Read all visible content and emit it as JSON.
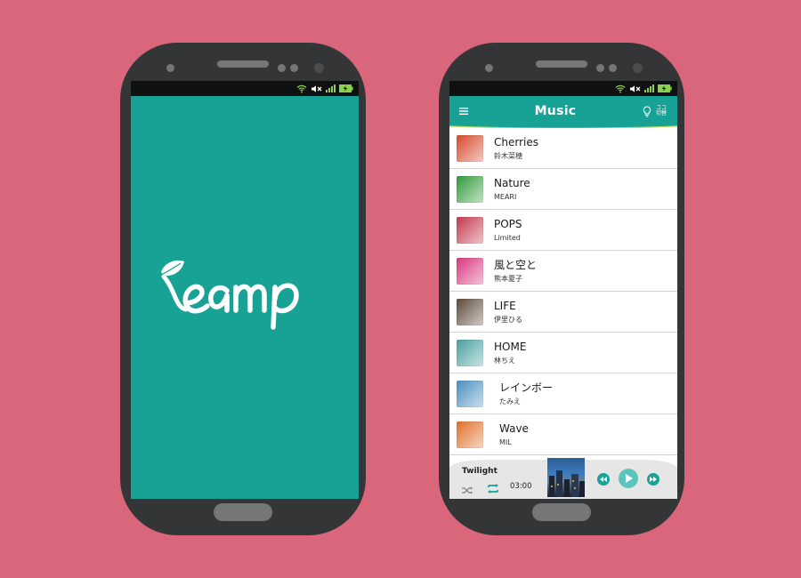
{
  "splash": {
    "logo_text": "eamp",
    "colors": {
      "background": "#17a295",
      "logo": "#ffffff"
    }
  },
  "status_bar": {
    "icons": [
      "wifi-icon",
      "mute-icon",
      "signal-icon",
      "battery-charging-icon"
    ]
  },
  "app": {
    "title": "Music",
    "menu_icon": "hamburger-icon",
    "right_icon": "lightbulb-icon",
    "right_badge": "ココ\n切替",
    "accent": "#17a295",
    "tracks": [
      {
        "title": "Cherries",
        "artist": "鈴木菜穂",
        "art": "cherries-art",
        "art_color": "#d5492a"
      },
      {
        "title": "Nature",
        "artist": "MEARI",
        "art": "nature-art",
        "art_color": "#2f9a3a"
      },
      {
        "title": "POPS",
        "artist": "Limited",
        "art": "pops-art",
        "art_color": "#c4374b"
      },
      {
        "title": "風と空と",
        "artist": "熊本夏子",
        "art": "flowers-art",
        "art_color": "#d8367f"
      },
      {
        "title": "LIFE",
        "artist": "伊里ひる",
        "art": "building-art",
        "art_color": "#5d4a3a"
      },
      {
        "title": "HOME",
        "artist": "林ちえ",
        "art": "house-art",
        "art_color": "#4aa0a0"
      },
      {
        "title": "レインボー",
        "artist": "たみえ",
        "art": "sky-art",
        "art_color": "#4a8fbf"
      },
      {
        "title": "Wave",
        "artist": "MIL",
        "art": "rainbow-art",
        "art_color": "#e0702a"
      }
    ],
    "player": {
      "now_playing": "Twilight",
      "time": "03:00",
      "controls": [
        "rewind-icon",
        "play-icon",
        "fast-forward-icon"
      ],
      "art": "city-art"
    }
  }
}
